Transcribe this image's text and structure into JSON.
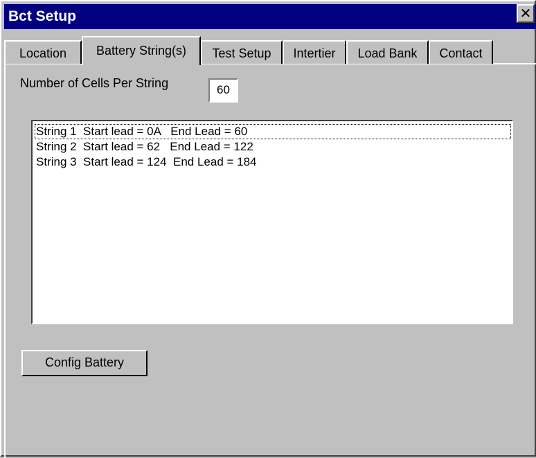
{
  "window": {
    "title": "Bct Setup",
    "close_glyph": "✕"
  },
  "tabs": [
    {
      "label": "Location",
      "active": false
    },
    {
      "label": "Battery String(s)",
      "active": true
    },
    {
      "label": "Test Setup",
      "active": false
    },
    {
      "label": "Intertier",
      "active": false
    },
    {
      "label": "Load Bank",
      "active": false
    },
    {
      "label": "Contact",
      "active": false
    }
  ],
  "battery_strings": {
    "cells_label": "Number of Cells Per String",
    "cells_value": "60",
    "strings": [
      {
        "text": "String 1  Start lead = 0A   End Lead = 60"
      },
      {
        "text": "String 2  Start lead = 62   End Lead = 122"
      },
      {
        "text": "String 3  Start lead = 124  End Lead = 184"
      }
    ],
    "config_button": "Config Battery"
  }
}
